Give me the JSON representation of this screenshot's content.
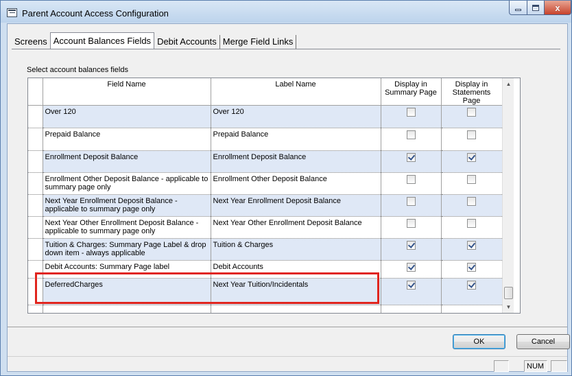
{
  "window": {
    "title": "Parent Account Access Configuration",
    "minimize_label": "",
    "close_label": "x"
  },
  "tabs": [
    {
      "label": "Screens"
    },
    {
      "label": "Account Balances Fields"
    },
    {
      "label": "Debit Accounts"
    },
    {
      "label": "Merge Field Links"
    }
  ],
  "section_label": "Select account balances fields",
  "table": {
    "columns": [
      "Field Name",
      "Label Name",
      "Display in Summary Page",
      "Display in Statements Page"
    ],
    "rows": [
      {
        "field": "Over 120",
        "label": "Over 120",
        "summary": false,
        "statements": false
      },
      {
        "field": "Prepaid Balance",
        "label": "Prepaid Balance",
        "summary": false,
        "statements": false
      },
      {
        "field": "Enrollment Deposit Balance",
        "label": "Enrollment Deposit Balance",
        "summary": true,
        "statements": true
      },
      {
        "field": "Enrollment Other Deposit Balance - applicable to summary page only",
        "label": "Enrollment Other Deposit Balance",
        "summary": false,
        "statements": false
      },
      {
        "field": "Next Year Enrollment Deposit Balance - applicable to summary page only",
        "label": "Next Year Enrollment Deposit Balance",
        "summary": false,
        "statements": false
      },
      {
        "field": "Next Year Other Enrollment Deposit Balance - applicable to summary page only",
        "label": "Next Year Other Enrollment Deposit Balance",
        "summary": false,
        "statements": false
      },
      {
        "field": "Tuition & Charges: Summary Page Label & drop down item - always applicable",
        "label": "Tuition & Charges",
        "summary": true,
        "statements": true
      },
      {
        "field": "Debit Accounts: Summary Page label",
        "label": "Debit Accounts",
        "summary": true,
        "statements": true
      },
      {
        "field": "DeferredCharges",
        "label": "Next Year Tuition/Incidentals",
        "summary": true,
        "statements": true
      }
    ]
  },
  "buttons": {
    "ok": "OK",
    "cancel": "Cancel"
  },
  "status": {
    "num": "NUM"
  },
  "colors": {
    "highlight": "#e0251e",
    "row_shade": "#dfe8f6",
    "title_bg": "#cfdff0"
  }
}
